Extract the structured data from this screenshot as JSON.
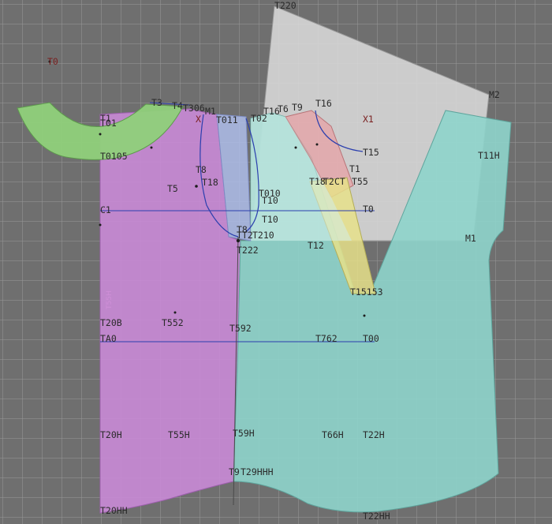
{
  "labels": {
    "t220": "T220",
    "t0_top": "T0",
    "m2": "M2",
    "t3": "T3",
    "t4": "T4",
    "t306": "T306",
    "t_x": "X",
    "t_m1": "M1",
    "t1": "T1",
    "t01": "T01",
    "t011": "T011",
    "t02": "T02",
    "t16a": "T16",
    "t6": "T6",
    "t9": "T9",
    "t16b": "T16",
    "x1": "X1",
    "t0105": "T0105",
    "t15": "T15",
    "t11h": "T11H",
    "t8": "T8",
    "t18": "T18",
    "t1_mid": "T1",
    "t18_r": "T18",
    "t2": "T2",
    "tct": "CT",
    "t55": "T55",
    "t5": "T5",
    "t010": "T010",
    "t10a": "T10",
    "t10b": "T10",
    "c1": "C1",
    "t0_mid": "T0",
    "ty8": "T8",
    "t210": "T210",
    "tt2": "TT2",
    "t222": "T222",
    "t12": "T12",
    "m1_r": "M1",
    "t15153": "T15153",
    "t20b": "T20B",
    "t552": "T552",
    "t592": "T592",
    "ta0": "TA0",
    "t762": "T762",
    "t00": "T00",
    "t20h": "T20H",
    "t55h": "T55H",
    "t59h": "T59H",
    "t66h": "T66H",
    "t22h": "T22H",
    "t9_btm": "T9",
    "t29hhh": "T29HHH",
    "t20hh": "T20HH",
    "t22hh": "T22HH",
    "side_vert": "T55H"
  },
  "colors": {
    "canvas_bg": "#6f6f6f",
    "collar_piece": "#8fd07a",
    "front_piece": "#c889d6",
    "sleeve_gray": "#d8d8d8",
    "back_piece": "#8fd4cc",
    "facing_blue": "#b0bde8",
    "strip_yellow": "#e6e089",
    "strip_red": "#e8a3a6",
    "guide_line": "#2b3fae"
  },
  "icons": {
    "point_marker": "cross-marker-icon"
  }
}
